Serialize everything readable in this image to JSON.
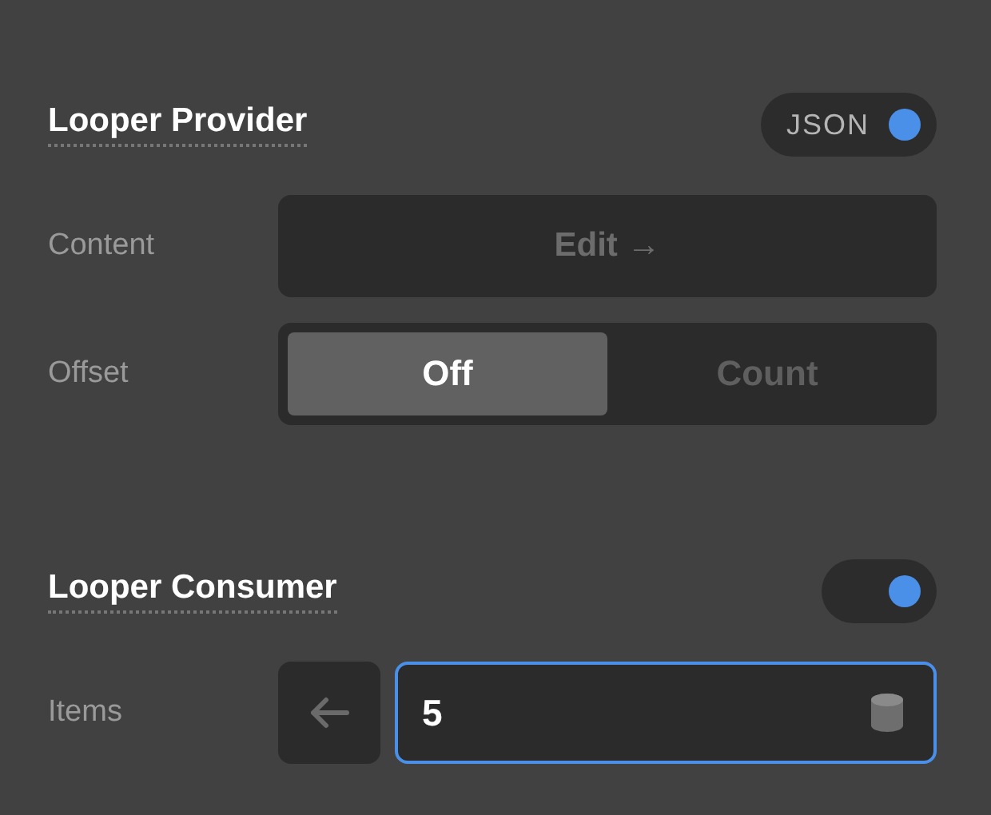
{
  "sections": [
    {
      "title": "Looper Provider",
      "toggle": {
        "label": "JSON",
        "on": true
      },
      "rows": [
        {
          "kind": "button",
          "label": "Content",
          "button": "Edit →"
        },
        {
          "kind": "segmented",
          "label": "Offset",
          "options": [
            {
              "label": "Off",
              "selected": true
            },
            {
              "label": "Count",
              "selected": false
            }
          ]
        }
      ]
    },
    {
      "title": "Looper Consumer",
      "toggle": {
        "on": true
      },
      "rows": [
        {
          "kind": "number",
          "label": "Items",
          "value": "5"
        }
      ]
    }
  ]
}
